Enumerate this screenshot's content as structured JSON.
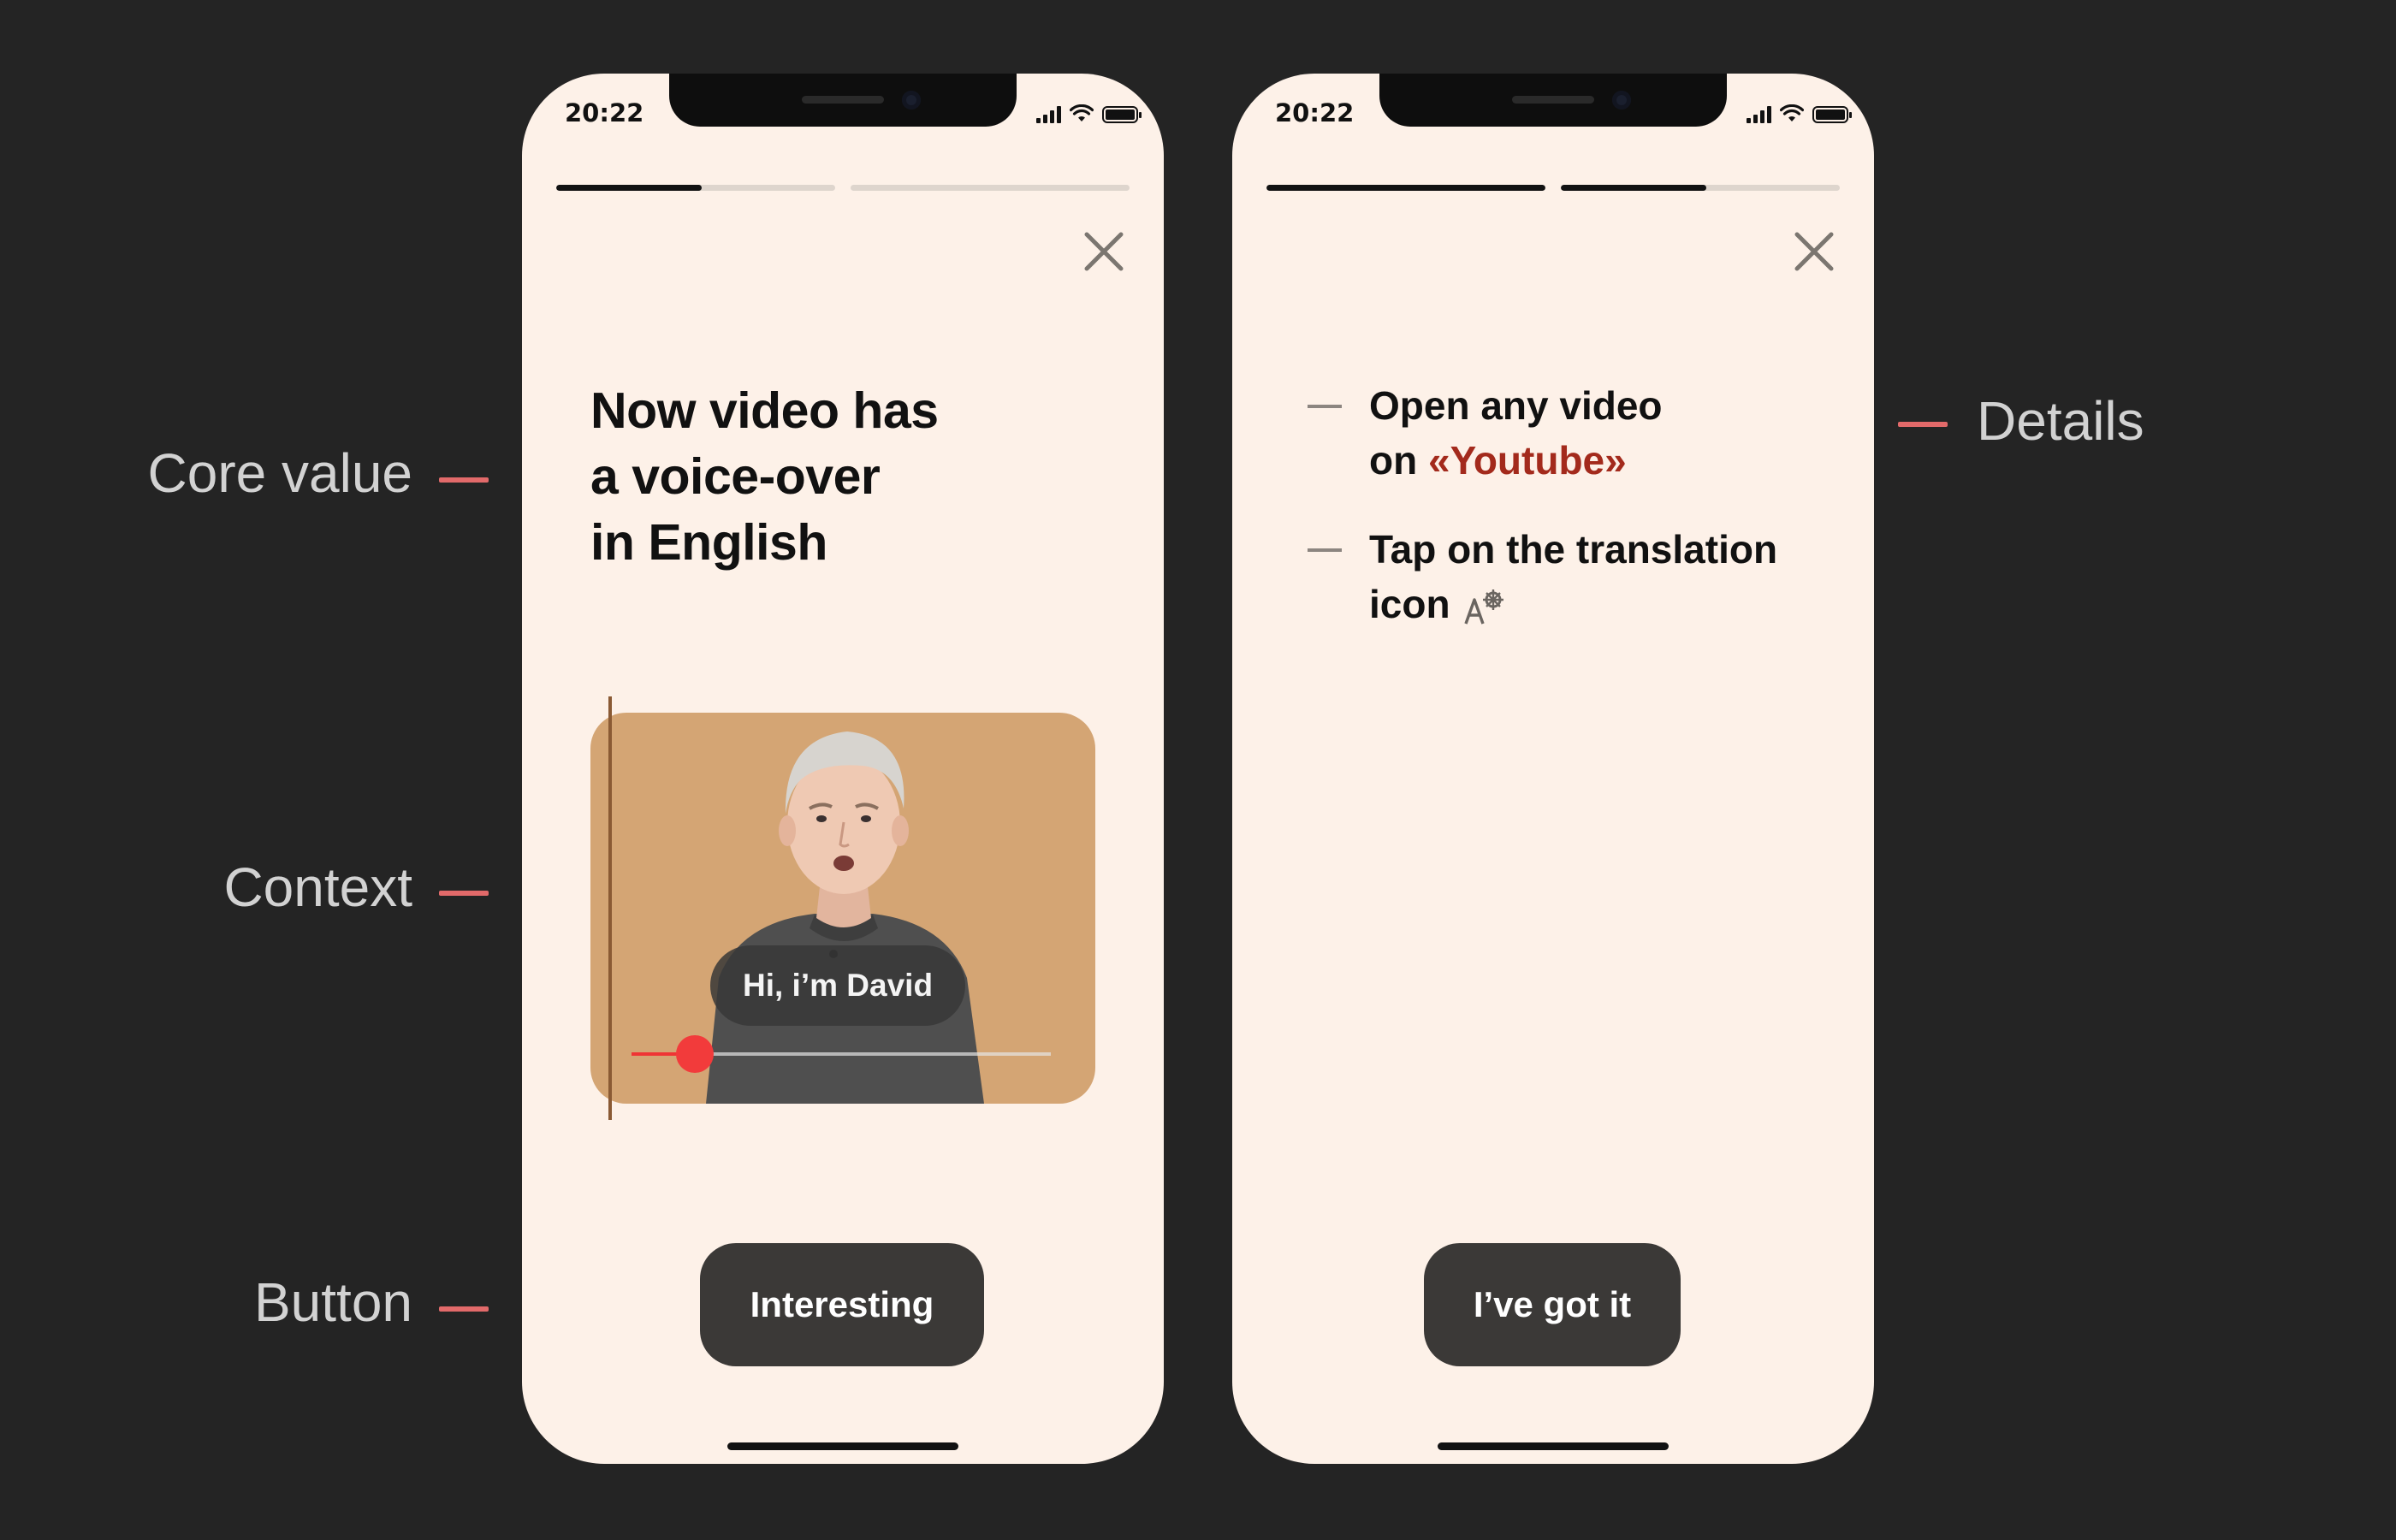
{
  "annotations": {
    "core_value": "Core value",
    "context": "Context",
    "button": "Button",
    "details": "Details",
    "dash_color": "#e26a6a"
  },
  "screen1": {
    "status_time": "20:22",
    "progress": [
      0.52,
      0.0
    ],
    "title_lines": [
      "Now video has",
      "a voice-over",
      "in English"
    ],
    "video": {
      "subtitle": "Hi, i’m David",
      "background_color": "#d4a574",
      "playback_progress": 0.15
    },
    "button_label": "Interesting"
  },
  "screen2": {
    "status_time": "20:22",
    "progress": [
      1.0,
      0.52
    ],
    "steps": [
      {
        "line1": "Open any video",
        "line2_prefix": "on ",
        "line2_highlight": "«Youtube»"
      },
      {
        "line1": "Tap on the translation",
        "line2_prefix": "icon",
        "icon": "translate-icon"
      }
    ],
    "button_label": "I’ve got it"
  },
  "colors": {
    "background": "#242424",
    "phone_surface": "#fdf1e8",
    "button": "#3b3937",
    "youtube_accent": "#a32a1c",
    "scrubber": "#f23b3b"
  }
}
